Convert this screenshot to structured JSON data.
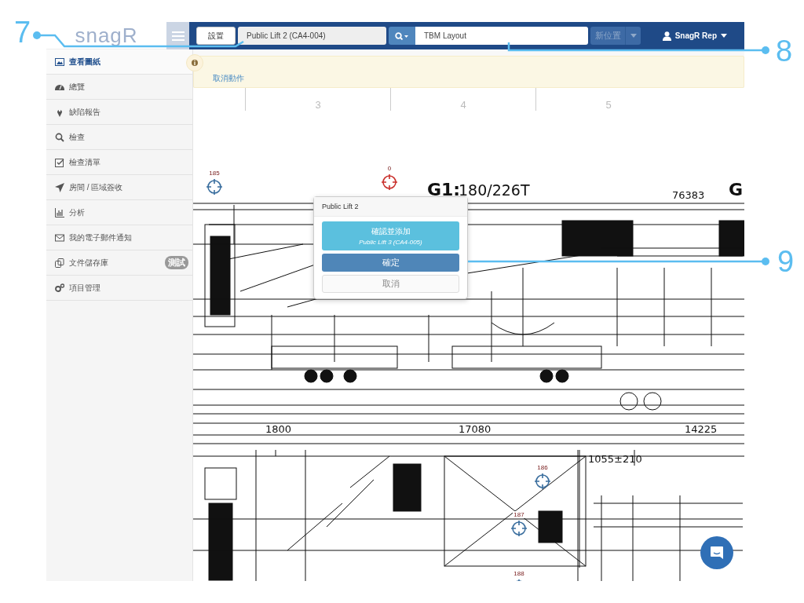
{
  "header": {
    "logo": "snagR",
    "set_button": "設置",
    "location_field": "Public Lift 2 (CA4-004)",
    "search_input": "TBM Layout",
    "new_location_button": {
      "label": "新位置",
      "disabled": true
    },
    "user_menu": "SnagR Rep"
  },
  "sidebar": {
    "items": [
      {
        "label": "查看圖紙",
        "kind": "image",
        "selected": true
      },
      {
        "label": "總覽",
        "kind": "dashboard",
        "selected": false
      },
      {
        "label": "缺陷報告",
        "kind": "pin",
        "selected": false
      },
      {
        "label": "檢查",
        "kind": "search",
        "selected": false
      },
      {
        "label": "檢查清單",
        "kind": "checklist",
        "selected": false
      },
      {
        "label": "房間 / 區域簽收",
        "kind": "arrow",
        "selected": false
      },
      {
        "label": "分析",
        "kind": "chart",
        "selected": false
      },
      {
        "label": "我的電子郵件通知",
        "kind": "mail",
        "selected": false
      },
      {
        "label": "文件儲存庫",
        "kind": "docs",
        "selected": false,
        "badge": "測試"
      },
      {
        "label": "項目管理",
        "kind": "cogs",
        "selected": false
      }
    ]
  },
  "alert": {
    "link": "取消動作"
  },
  "ruler": {
    "labels": [
      "3",
      "4",
      "5"
    ]
  },
  "drawing": {
    "texts": [
      "G1:",
      "180/226T",
      "76383",
      "G",
      "1800",
      "17080",
      "14225",
      "1055±210"
    ]
  },
  "markers": [
    {
      "label": "185",
      "active": false
    },
    {
      "label": "0",
      "active": true
    },
    {
      "label": "186",
      "active": false
    },
    {
      "label": "187",
      "active": false
    },
    {
      "label": "188",
      "active": false
    }
  ],
  "popup": {
    "title": "Public Lift 2",
    "confirm_add": {
      "label": "確認並添加",
      "subtitle": "Public Lift 3 (CA4-005)"
    },
    "confirm": "確定",
    "cancel": "取消"
  },
  "callouts": [
    "7",
    "8",
    "9"
  ]
}
